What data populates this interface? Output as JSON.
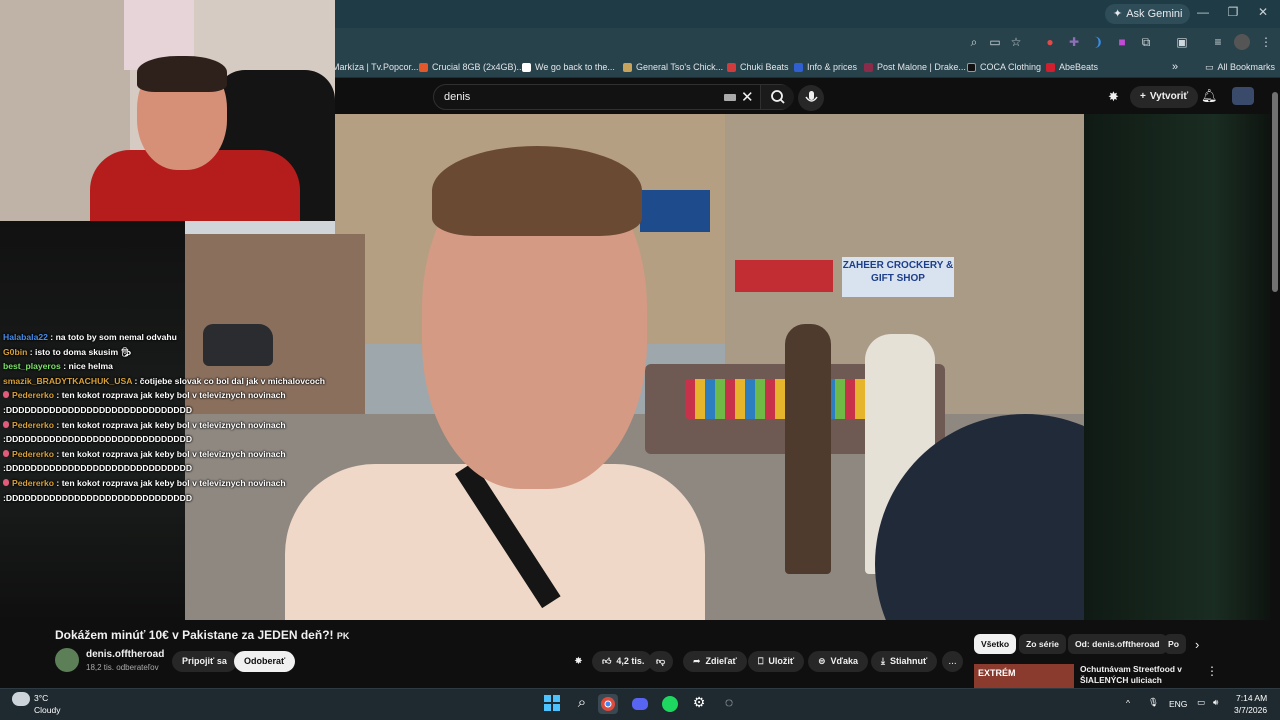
{
  "browser": {
    "ask_gemini": "Ask Gemini",
    "bookmarks": [
      {
        "label": "Markíza | Tv.Popcor...",
        "color": "#2d6ad6"
      },
      {
        "label": "Crucial 8GB (2x4GB)...",
        "color": "#e3572a"
      },
      {
        "label": "We go back to the...",
        "color": "#ffffff"
      },
      {
        "label": "General Tso's Chick...",
        "color": "#c7a35c"
      },
      {
        "label": "Chuki Beats",
        "color": "#d23b3b"
      },
      {
        "label": "Info & prices",
        "color": "#2f5fd1"
      },
      {
        "label": "Post Malone | Drake...",
        "color": "#8b2b4a"
      },
      {
        "label": "COCA Clothing",
        "color": "#111111"
      },
      {
        "label": "AbeBeats",
        "color": "#d21f2f"
      }
    ],
    "bookmarks_more": "»",
    "all_bookmarks": "All Bookmarks"
  },
  "youtube": {
    "search_value": "denis",
    "create_label": "Vytvoriť",
    "video": {
      "signs": [
        "ZAHEER CROCKERY & GIFT SHOP"
      ]
    },
    "title": "Dokážem minúť 10€ v Pakistane za JEDEN deň?! 🇵🇰",
    "title_text": "Dokážem minúť 10€ v Pakistane za JEDEN deň?!",
    "title_flag": "PK",
    "channel": "denis.offtheroad",
    "subscribers": "18,2 tis. odberateľov",
    "join_label": "Pripojiť sa",
    "subscribe_label": "Odoberať",
    "like_count": "4,2 tis.",
    "share_label": "Zdieľať",
    "save_label": "Uložiť",
    "thanks_label": "Vďaka",
    "download_label": "Stiahnuť",
    "more_label": "...",
    "chips": [
      "Všetko",
      "Zo série",
      "Od: denis.offtheroad",
      "Po"
    ],
    "recommendation": {
      "thumb_text": "EXTRÉM",
      "title": "Ochutnávam Streetfood v ŠIALENÝCH uliciach Pakistan..."
    }
  },
  "chat": [
    {
      "user": "Halabala22",
      "color": "#4a8ce8",
      "badge": false,
      "text": "na toto by som nemal odvahu"
    },
    {
      "user": "G0bin",
      "color": "#d9a13a",
      "badge": false,
      "text": "isto to doma skusim"
    },
    {
      "user": "best_playeros",
      "color": "#7ce26a",
      "badge": false,
      "text": "nice helma"
    },
    {
      "user": "smazik_BRADYTKACHUK_USA",
      "color": "#d9a13a",
      "badge": false,
      "text": "čotijebe slovak co bol dal jak v michalovcoch"
    },
    {
      "user": "Pedererko",
      "color": "#d9a13a",
      "badge": true,
      "text": "ten kokot rozprava jak keby bol v televiznych novinach",
      "cont": ":DDDDDDDDDDDDDDDDDDDDDDDDDDDDDD"
    },
    {
      "user": "Pedererko",
      "color": "#d9a13a",
      "badge": true,
      "text": "ten kokot rozprava jak keby bol v televiznych novinach",
      "cont": ":DDDDDDDDDDDDDDDDDDDDDDDDDDDDDD"
    },
    {
      "user": "Pedererko",
      "color": "#d9a13a",
      "badge": true,
      "text": "ten kokot rozprava jak keby bol v televiznych novinach",
      "cont": ":DDDDDDDDDDDDDDDDDDDDDDDDDDDDDD"
    },
    {
      "user": "Pedererko",
      "color": "#d9a13a",
      "badge": true,
      "text": "ten kokot rozprava jak keby bol v televiznych novinach",
      "cont": ":DDDDDDDDDDDDDDDDDDDDDDDDDDDDDD"
    }
  ],
  "taskbar": {
    "temperature": "3°C",
    "weather": "Cloudy",
    "language": "ENG",
    "time": "7:14 AM",
    "date": "3/7/2026"
  }
}
